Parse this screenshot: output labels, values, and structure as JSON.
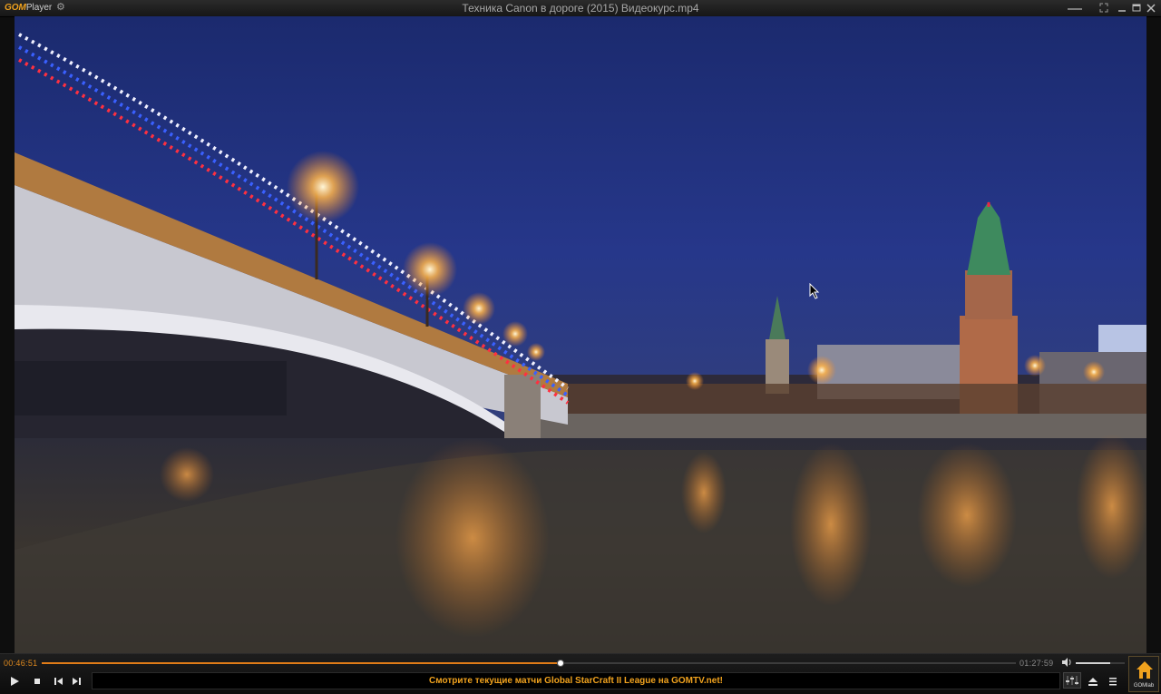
{
  "app": {
    "logo_gom": "GOM",
    "logo_player": "Player",
    "window_title": "Техника Canon в дороге (2015) Видеокурс.mp4"
  },
  "icons": {
    "settings": "gear-icon",
    "minimize": "minimize-icon",
    "compact": "compact-mode-icon",
    "restore": "restore-icon",
    "close": "close-icon",
    "volume": "speaker-icon",
    "play": "play-icon",
    "stop": "stop-icon",
    "previous": "previous-icon",
    "next": "next-icon",
    "equalizer": "equalizer-icon",
    "eject": "eject-icon",
    "menu": "playlist-menu-icon",
    "gomlab": "home-icon",
    "cursor": "mouse-cursor-icon"
  },
  "playback": {
    "current_time": "00:46:51",
    "total_time": "01:27:59",
    "progress": 0.5325,
    "volume": 0.7
  },
  "ticker": {
    "text": "Смотрите текущие матчи Global StarCraft II League на GOMTV.net!"
  },
  "gomlab": {
    "label": "GOMlab"
  },
  "colors": {
    "accent": "#e07c18",
    "ticker_text": "#f0a21e",
    "background": "#0e0e0e"
  }
}
